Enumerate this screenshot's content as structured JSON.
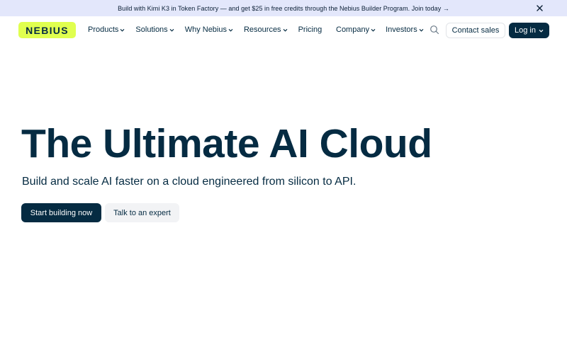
{
  "banner": {
    "text": "Build with Kimi K3 in Token Factory — and get $25 in free credits through the Nebius Builder Program. Join today →"
  },
  "nav": {
    "logo": "NEBIUS",
    "left_items": [
      {
        "label": "Products"
      },
      {
        "label": "Solutions"
      },
      {
        "label": "Why Nebius"
      },
      {
        "label": "Resources"
      },
      {
        "label": "Pricing"
      }
    ],
    "right_items": [
      {
        "label": "Company"
      },
      {
        "label": "Investors"
      }
    ],
    "contact_label": "Contact sales",
    "login_label": "Log in"
  },
  "hero": {
    "title": "The Ultimate AI Cloud",
    "subtitle": "Build and scale AI faster on a cloud engineered from silicon to API.",
    "primary_cta": "Start building now",
    "secondary_cta": "Talk to an expert"
  },
  "colors": {
    "brand_dark": "#052b42",
    "brand_lime": "#e0ff4f",
    "banner_bg": "#e3e7fb"
  }
}
